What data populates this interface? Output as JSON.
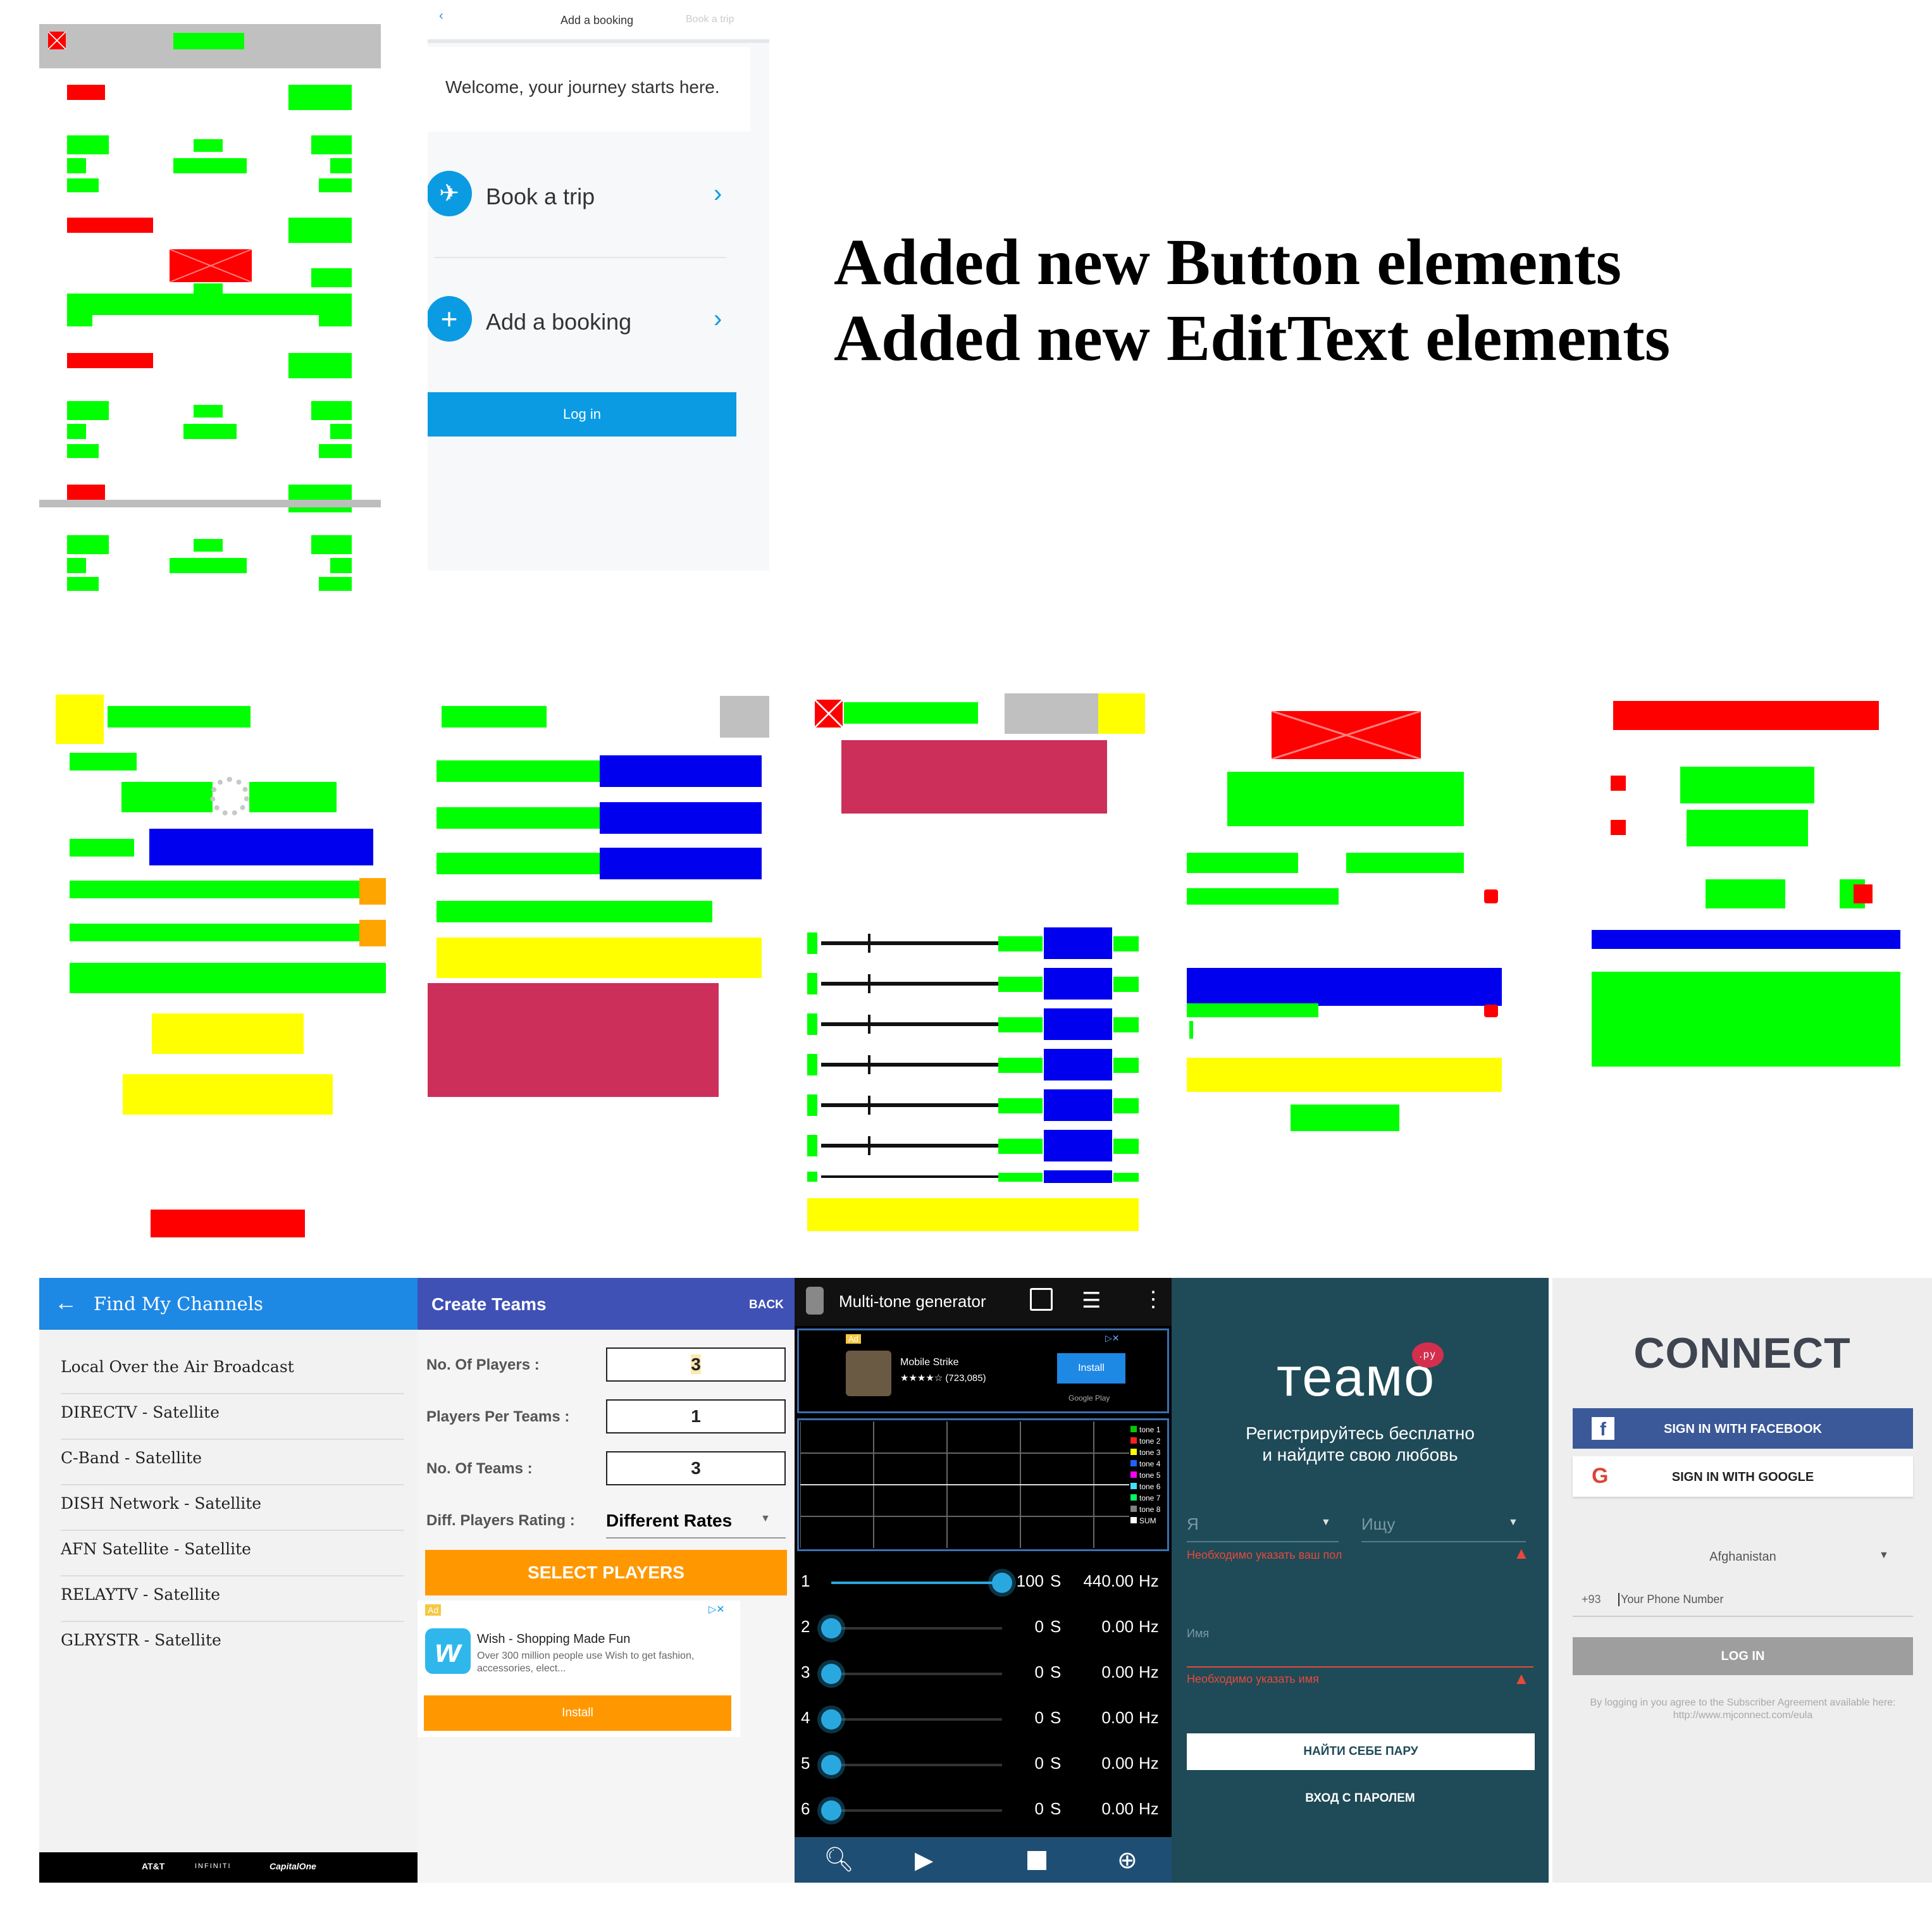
{
  "headline": {
    "line1": "Added new Button elements",
    "line2": "Added new EditText elements"
  },
  "booking": {
    "top_center": "Add a booking",
    "top_right": "Book a trip",
    "welcome": "Welcome, your journey starts here.",
    "item1": "Book a trip",
    "item2": "Add a booking",
    "login": "Log in"
  },
  "channels": {
    "title": "Find My Channels",
    "items": [
      "Local Over the Air Broadcast",
      "DIRECTV - Satellite",
      "C-Band - Satellite",
      "DISH Network - Satellite",
      "AFN Satellite - Satellite",
      "RELAYTV - Satellite",
      "GLRYSTR - Satellite"
    ],
    "footer": [
      "AT&T",
      "INFINITI",
      "CapitalOne"
    ]
  },
  "teams": {
    "title": "Create Teams",
    "back": "BACK",
    "label1": "No. Of Players :",
    "value1": "3",
    "label2": "Players Per Teams :",
    "value2": "1",
    "label3": "No. Of Teams :",
    "value3": "3",
    "label4": "Diff. Players Rating :",
    "value4": "Different Rates",
    "select": "SELECT PLAYERS",
    "ad_badge": "Ad",
    "ad_title": "Wish - Shopping Made Fun",
    "ad_desc": "Over 300 million people use Wish to get fashion, accessories, elect...",
    "ad_install": "Install"
  },
  "tone": {
    "title": "Multi-tone generator",
    "ad_badge": "Ad",
    "ad_name": "Mobile Strike",
    "ad_rating": "★★★★☆ (723,085)",
    "ad_install": "Install",
    "ad_store": "Google Play",
    "legend": [
      "tone 1",
      "tone 2",
      "tone 3",
      "tone 4",
      "tone 5",
      "tone 6",
      "tone 7",
      "tone 8",
      "SUM"
    ],
    "legend_colors": [
      "#00cc00",
      "#ff2020",
      "#ffff00",
      "#2060ff",
      "#ff00ff",
      "#40e0ff",
      "#00ff60",
      "#808080",
      "#ffffff"
    ],
    "rows": [
      {
        "n": "1",
        "vol": "100",
        "s": "S",
        "hz": "440.00",
        "unit": "Hz"
      },
      {
        "n": "2",
        "vol": "0",
        "s": "S",
        "hz": "0.00",
        "unit": "Hz"
      },
      {
        "n": "3",
        "vol": "0",
        "s": "S",
        "hz": "0.00",
        "unit": "Hz"
      },
      {
        "n": "4",
        "vol": "0",
        "s": "S",
        "hz": "0.00",
        "unit": "Hz"
      },
      {
        "n": "5",
        "vol": "0",
        "s": "S",
        "hz": "0.00",
        "unit": "Hz"
      },
      {
        "n": "6",
        "vol": "0",
        "s": "S",
        "hz": "0.00",
        "unit": "Hz"
      }
    ]
  },
  "teamo": {
    "logo": "теамо",
    "logo_badge": ".ру",
    "tagline1": "Регистрируйтесь бесплатно",
    "tagline2": "и найдите свою любовь",
    "i_am": "Я",
    "seeking": "Ищу",
    "err_gender": "Необходимо указать ваш пол",
    "name": "Имя",
    "err_name": "Необходимо указать имя",
    "find": "НАЙТИ СЕБЕ ПАРУ",
    "login": "ВХОД С ПАРОЛЕМ"
  },
  "connect": {
    "title": "CONNECT",
    "facebook": "SIGN IN WITH FACEBOOK",
    "google": "SIGN IN WITH GOOGLE",
    "country": "Afghanistan",
    "code": "+93",
    "phone_placeholder": "Your Phone Number",
    "login": "LOG IN",
    "terms": "By logging in you agree to the Subscriber Agreement available here: http://www.mjconnect.com/eula"
  },
  "colors": {
    "accent_blue": "#0a9be3",
    "channels_bar": "#1e88e5",
    "teams_bar": "#3f51b5",
    "orange": "#ff9800",
    "teamo_bg": "#1f4a58",
    "facebook": "#3b5998"
  }
}
